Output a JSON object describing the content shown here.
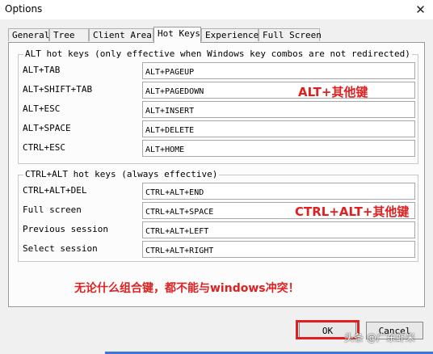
{
  "window": {
    "title": "Options",
    "close_glyph": "✕"
  },
  "tabs": [
    {
      "label": "General",
      "active": false
    },
    {
      "label": "Tree",
      "active": false
    },
    {
      "label": "Client Area",
      "active": false
    },
    {
      "label": "Hot Keys",
      "active": true
    },
    {
      "label": "Experience",
      "active": false
    },
    {
      "label": "Full Screen",
      "active": false
    }
  ],
  "alt_group": {
    "legend": "ALT hot keys (only effective when Windows key combos are not redirected)",
    "rows": [
      {
        "label": "ALT+TAB",
        "value": "ALT+PAGEUP"
      },
      {
        "label": "ALT+SHIFT+TAB",
        "value": "ALT+PAGEDOWN"
      },
      {
        "label": "ALT+ESC",
        "value": "ALT+INSERT"
      },
      {
        "label": "ALT+SPACE",
        "value": "ALT+DELETE"
      },
      {
        "label": "CTRL+ESC",
        "value": "ALT+HOME"
      }
    ]
  },
  "ctrl_alt_group": {
    "legend": "CTRL+ALT hot keys (always effective)",
    "rows": [
      {
        "label": "CTRL+ALT+DEL",
        "value": "CTRL+ALT+END"
      },
      {
        "label": "Full screen",
        "value": "CTRL+ALT+SPACE"
      },
      {
        "label": "Previous session",
        "value": "CTRL+ALT+LEFT"
      },
      {
        "label": "Select session",
        "value": "CTRL+ALT+RIGHT"
      }
    ]
  },
  "annotations": {
    "alt_note": "ALT+其他键",
    "ctrl_alt_note": "CTRL+ALT+其他键",
    "bottom_note": "无论什么组合键，都不能与windows冲突！",
    "color": "#e02020"
  },
  "buttons": {
    "ok": "OK",
    "cancel": "Cancel"
  },
  "watermark": "头条 @广东虾米"
}
